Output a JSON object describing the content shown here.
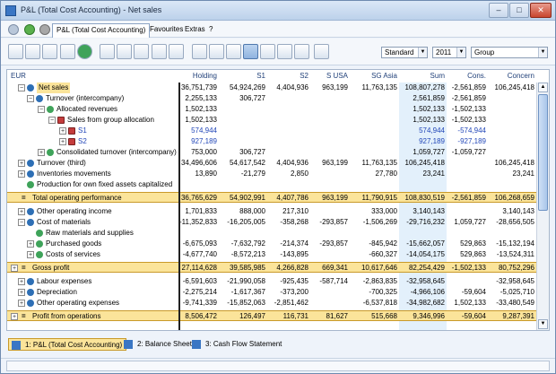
{
  "window": {
    "title": "P&L (Total Cost Accounting) - Net sales",
    "minimize": "–",
    "maximize": "□",
    "close": "✕"
  },
  "menu": {
    "active_tab": "P&L (Total Cost Accounting)",
    "items": [
      "Favourites",
      "Extras",
      "?"
    ]
  },
  "toolbar": {
    "scenario": "Standard",
    "year": "2011",
    "group": "Group"
  },
  "grid": {
    "corner_label": "EUR",
    "columns": [
      "Holding",
      "S1",
      "S2",
      "S USA",
      "SG Asia",
      "Sum",
      "Cons.",
      "Concern"
    ],
    "rows": [
      {
        "label": "Net sales",
        "values": [
          "36,751,739",
          "54,924,269",
          "4,404,936",
          "963,199",
          "11,763,135",
          "108,807,278",
          "-2,561,859",
          "106,245,418"
        ]
      },
      {
        "label": "Turnover (intercompany)",
        "values": [
          "2,255,133",
          "306,727",
          "",
          "",
          "",
          "2,561,859",
          "-2,561,859",
          ""
        ]
      },
      {
        "label": "Allocated revenues",
        "values": [
          "1,502,133",
          "",
          "",
          "",
          "",
          "1,502,133",
          "-1,502,133",
          ""
        ]
      },
      {
        "label": "Sales from group allocation",
        "values": [
          "1,502,133",
          "",
          "",
          "",
          "",
          "1,502,133",
          "-1,502,133",
          ""
        ]
      },
      {
        "label": "S1",
        "values": [
          "574,944",
          "",
          "",
          "",
          "",
          "574,944",
          "-574,944",
          ""
        ]
      },
      {
        "label": "S2",
        "values": [
          "927,189",
          "",
          "",
          "",
          "",
          "927,189",
          "-927,189",
          ""
        ]
      },
      {
        "label": "Consolidated turnover (intercompany)",
        "values": [
          "753,000",
          "306,727",
          "",
          "",
          "",
          "1,059,727",
          "-1,059,727",
          ""
        ]
      },
      {
        "label": "Turnover (third)",
        "values": [
          "34,496,606",
          "54,617,542",
          "4,404,936",
          "963,199",
          "11,763,135",
          "106,245,418",
          "",
          "106,245,418"
        ]
      },
      {
        "label": "Inventories movements",
        "values": [
          "13,890",
          "-21,279",
          "2,850",
          "",
          "27,780",
          "23,241",
          "",
          "23,241"
        ]
      },
      {
        "label": "Production for own fixed assets capitalized",
        "values": [
          "",
          "",
          "",
          "",
          "",
          "",
          "",
          ""
        ]
      },
      {
        "label": "Total operating performance",
        "values": [
          "36,765,629",
          "54,902,991",
          "4,407,786",
          "963,199",
          "11,790,915",
          "108,830,519",
          "-2,561,859",
          "106,268,659"
        ]
      },
      {
        "label": "Other operating income",
        "values": [
          "1,701,833",
          "888,000",
          "217,310",
          "",
          "333,000",
          "3,140,143",
          "",
          "3,140,143"
        ]
      },
      {
        "label": "Cost of materials",
        "values": [
          "-11,352,833",
          "-16,205,005",
          "-358,268",
          "-293,857",
          "-1,506,269",
          "-29,716,232",
          "1,059,727",
          "-28,656,505"
        ]
      },
      {
        "label": "Raw materials and supplies",
        "values": [
          "",
          "",
          "",
          "",
          "",
          "",
          "",
          ""
        ]
      },
      {
        "label": "Purchased goods",
        "values": [
          "-6,675,093",
          "-7,632,792",
          "-214,374",
          "-293,857",
          "-845,942",
          "-15,662,057",
          "529,863",
          "-15,132,194"
        ]
      },
      {
        "label": "Costs of services",
        "values": [
          "-4,677,740",
          "-8,572,213",
          "-143,895",
          "",
          "-660,327",
          "-14,054,175",
          "529,863",
          "-13,524,311"
        ]
      },
      {
        "label": "Gross profit",
        "values": [
          "27,114,628",
          "39,585,985",
          "4,266,828",
          "669,341",
          "10,617,646",
          "82,254,429",
          "-1,502,133",
          "80,752,296"
        ]
      },
      {
        "label": "Labour expenses",
        "values": [
          "-6,591,603",
          "-21,990,058",
          "-925,435",
          "-587,714",
          "-2,863,835",
          "-32,958,645",
          "",
          "-32,958,645"
        ]
      },
      {
        "label": "Depreciation",
        "values": [
          "-2,275,214",
          "-1,617,367",
          "-373,200",
          "",
          "-700,325",
          "-4,966,106",
          "-59,604",
          "-5,025,710"
        ]
      },
      {
        "label": "Other operating expenses",
        "values": [
          "-9,741,339",
          "-15,852,063",
          "-2,851,462",
          "",
          "-6,537,818",
          "-34,982,682",
          "1,502,133",
          "-33,480,549"
        ]
      },
      {
        "label": "Profit from operations",
        "values": [
          "8,506,472",
          "126,497",
          "116,731",
          "81,627",
          "515,668",
          "9,346,996",
          "-59,604",
          "9,287,391"
        ]
      }
    ],
    "equals_sign": "="
  },
  "sheets": [
    "1: P&L (Total Cost Accounting)",
    "2: Balance Sheet",
    "3: Cash Flow Statement"
  ],
  "colors": {
    "highlight": "#fbe49a",
    "sum_column": "#e3f0fb",
    "link_blue": "#2247b8"
  }
}
